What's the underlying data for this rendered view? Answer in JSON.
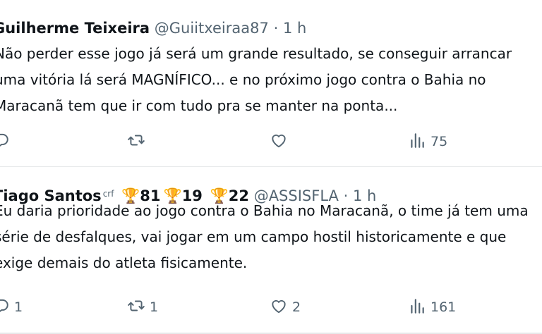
{
  "tweets": [
    {
      "name": "Guilherme Teixeira",
      "handle": "@Guiitxeiraa87",
      "separator": "·",
      "time": "1 h",
      "lines": [
        "Não perder esse jogo já será um grande resultado, se conseguir arrancar",
        "uma vitória lá será MAGNÍFICO... e no próximo jogo contra o Bahia no",
        "Maracanã tem que ir com tudo pra se manter na ponta..."
      ],
      "replies": "",
      "retweets": "",
      "likes": "",
      "views": "75"
    },
    {
      "name": "Tiago Santos",
      "name_suffix": "crf",
      "badges": [
        {
          "icon": "trophy-icon",
          "glyph": "🏆",
          "count": "81"
        },
        {
          "icon": "trophy-icon",
          "glyph": "🏆",
          "count": "19"
        },
        {
          "icon": "trophy-icon",
          "glyph": "🏆",
          "count": "22"
        }
      ],
      "handle": "@ASSISFLA",
      "separator": "·",
      "time": "1 h",
      "lines": [
        "Eu daria prioridade ao jogo contra o Bahia no Maracanã, o time já tem uma",
        "série de desfalques, vai jogar em um campo hostil historicamente e que",
        "exige demais do atleta fisicamente."
      ],
      "replies": "1",
      "retweets": "1",
      "likes": "2",
      "views": "161"
    }
  ],
  "icons": {
    "reply": "reply-icon",
    "retweet": "retweet-icon",
    "like": "heart-icon",
    "views": "views-icon"
  },
  "colors": {
    "text": "#0f1419",
    "secondary": "#536471",
    "divider": "#e7e9ea"
  }
}
